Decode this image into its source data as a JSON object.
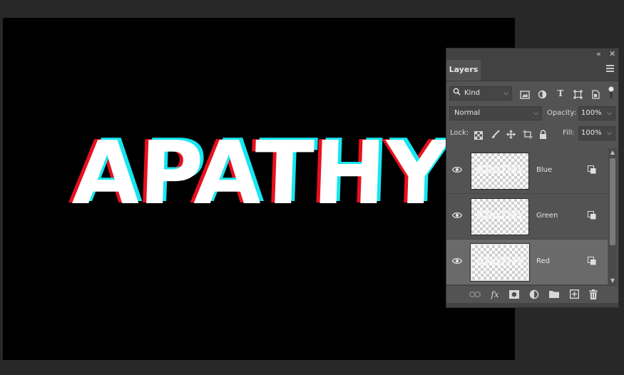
{
  "canvas": {
    "text": "APATHY",
    "colors": {
      "background": "#000000",
      "fill": "#ffffff",
      "red": "#e8101e",
      "cyan": "#16e6f0"
    }
  },
  "panel": {
    "collapse_icon": "double-chevron-left-icon",
    "close_icon": "close-icon",
    "tab_label": "Layers",
    "menu_icon": "hamburger-menu-icon",
    "filter": {
      "search_icon": "magnifier-icon",
      "kind_label": "Kind",
      "icons": [
        "image-filter-icon",
        "adjustment-filter-icon",
        "type-filter-icon",
        "shape-filter-icon",
        "smart-object-filter-icon"
      ],
      "toggle_icon": "filter-toggle-icon"
    },
    "blend": {
      "mode": "Normal",
      "opacity_label": "Opacity:",
      "opacity_value": "100%"
    },
    "lock": {
      "label": "Lock:",
      "icons": [
        "lock-transparent-pixels-icon",
        "lock-image-pixels-icon",
        "lock-position-icon",
        "lock-artboard-icon",
        "lock-all-icon"
      ],
      "fill_label": "Fill:",
      "fill_value": "100%"
    },
    "layers": [
      {
        "name": "Blue",
        "thumb_text": "APATHY",
        "selected": false
      },
      {
        "name": "Green",
        "thumb_text": "APATHY",
        "selected": false
      },
      {
        "name": "Red",
        "thumb_text": "APATHY",
        "selected": true
      }
    ],
    "footer_icons": [
      "link-layers-icon",
      "fx-icon",
      "add-mask-icon",
      "new-adjustment-layer-icon",
      "new-group-icon",
      "new-layer-icon",
      "delete-layer-icon"
    ],
    "fx_label": "fx"
  }
}
